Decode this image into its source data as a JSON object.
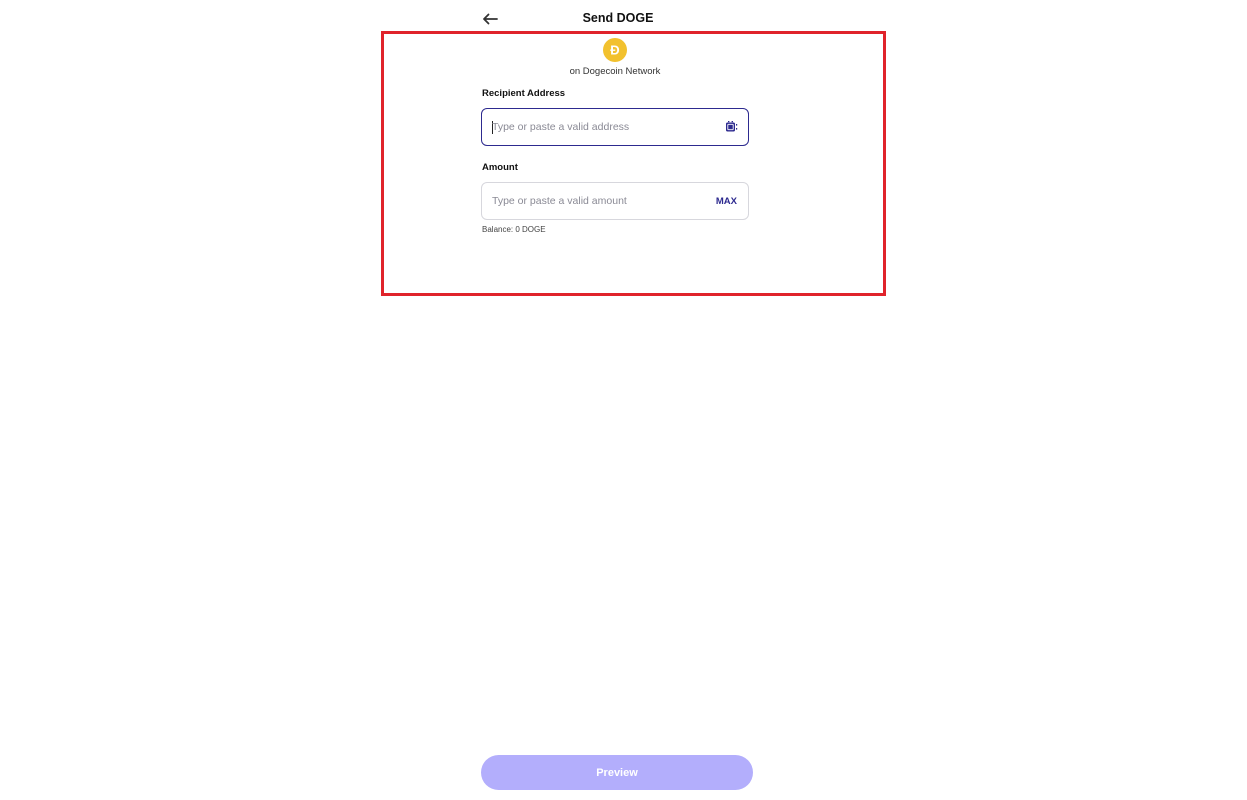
{
  "header": {
    "title": "Send DOGE",
    "back_icon": "arrow-left-icon"
  },
  "asset": {
    "icon": "dogecoin-icon",
    "icon_glyph": "Ð",
    "icon_color": "#f2c12e",
    "network_label": "on Dogecoin Network"
  },
  "recipient": {
    "label": "Recipient Address",
    "value": "",
    "placeholder": "Type or paste a valid address",
    "action_icon": "scan-icon"
  },
  "amount": {
    "label": "Amount",
    "value": "",
    "placeholder": "Type or paste a valid amount",
    "max_label": "MAX",
    "balance_text": "Balance: 0 DOGE"
  },
  "footer": {
    "preview_label": "Preview"
  },
  "colors": {
    "accent": "#2d2a8f",
    "button_disabled": "#b3aefc",
    "highlight": "#e0232b"
  }
}
